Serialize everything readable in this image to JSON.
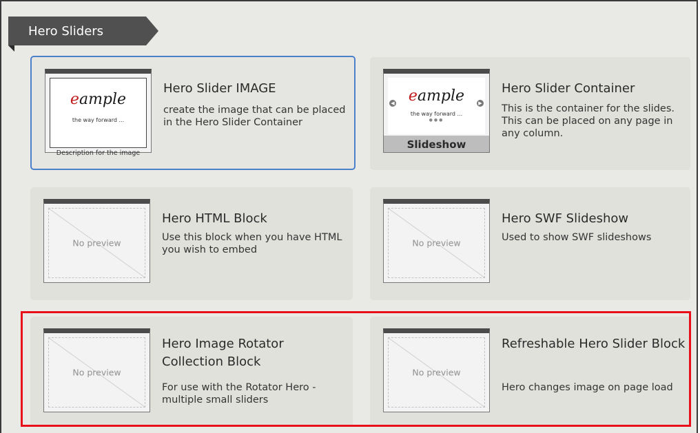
{
  "section": {
    "title": "Hero Sliders"
  },
  "blocks": [
    {
      "title": "Hero Slider IMAGE",
      "description": "create the image that can be placed in the Hero Slider Container",
      "preview": {
        "logo_mark": "e",
        "logo_text": "ample",
        "tagline": "the way forward ...",
        "caption": "Description for the image"
      }
    },
    {
      "title": "Hero Slider Container",
      "description": "This is the container for the slides. This can be placed on any page in any column.",
      "preview": {
        "logo_mark": "e",
        "logo_text": "ample",
        "tagline": "the way forward ...",
        "label": "Slideshow"
      }
    },
    {
      "title": "Hero HTML Block",
      "description": "Use this block when you have HTML you wish to embed",
      "preview": {
        "text": "No preview"
      }
    },
    {
      "title": "Hero SWF Slideshow",
      "description": "Used to show SWF slideshows",
      "preview": {
        "text": "No preview"
      }
    },
    {
      "title": "Hero Image Rotator Collection Block",
      "description": "For use with the Rotator Hero - multiple small sliders",
      "preview": {
        "text": "No preview"
      }
    },
    {
      "title": "Refreshable Hero Slider Block",
      "description": "Hero changes image on page load",
      "preview": {
        "text": "No preview"
      }
    }
  ],
  "colors": {
    "selected_border": "#4a80c9",
    "highlight": "#e8101a",
    "header_bg": "#505050"
  },
  "icons": {
    "arrow_left": "chevron-left-icon",
    "arrow_right": "chevron-right-icon",
    "no_preview": "no-preview-icon"
  }
}
